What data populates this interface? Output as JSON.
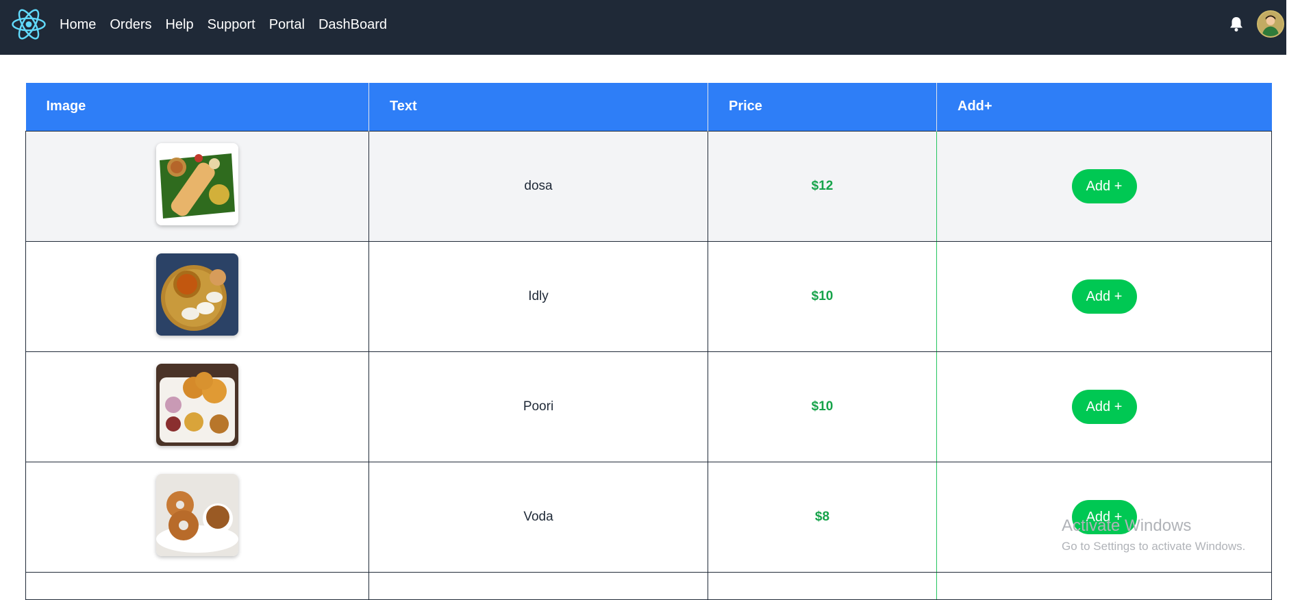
{
  "navbar": {
    "links": [
      "Home",
      "Orders",
      "Help",
      "Support",
      "Portal",
      "DashBoard"
    ]
  },
  "table": {
    "headers": [
      "Image",
      "Text",
      "Price",
      "Add+"
    ],
    "rows": [
      {
        "text": "dosa",
        "price": "$12",
        "button": "Add +",
        "image_icon": "dosa-plate-icon"
      },
      {
        "text": "Idly",
        "price": "$10",
        "button": "Add +",
        "image_icon": "idly-plate-icon"
      },
      {
        "text": "Poori",
        "price": "$10",
        "button": "Add +",
        "image_icon": "poori-plate-icon"
      },
      {
        "text": "Voda",
        "price": "$8",
        "button": "Add +",
        "image_icon": "vada-plate-icon"
      }
    ]
  },
  "watermark": {
    "title": "Activate Windows",
    "subtitle": "Go to Settings to activate Windows."
  },
  "colors": {
    "navbar_bg": "#1f2937",
    "header_bg": "#2e7ef7",
    "price": "#16a34a",
    "button": "#00c853"
  }
}
